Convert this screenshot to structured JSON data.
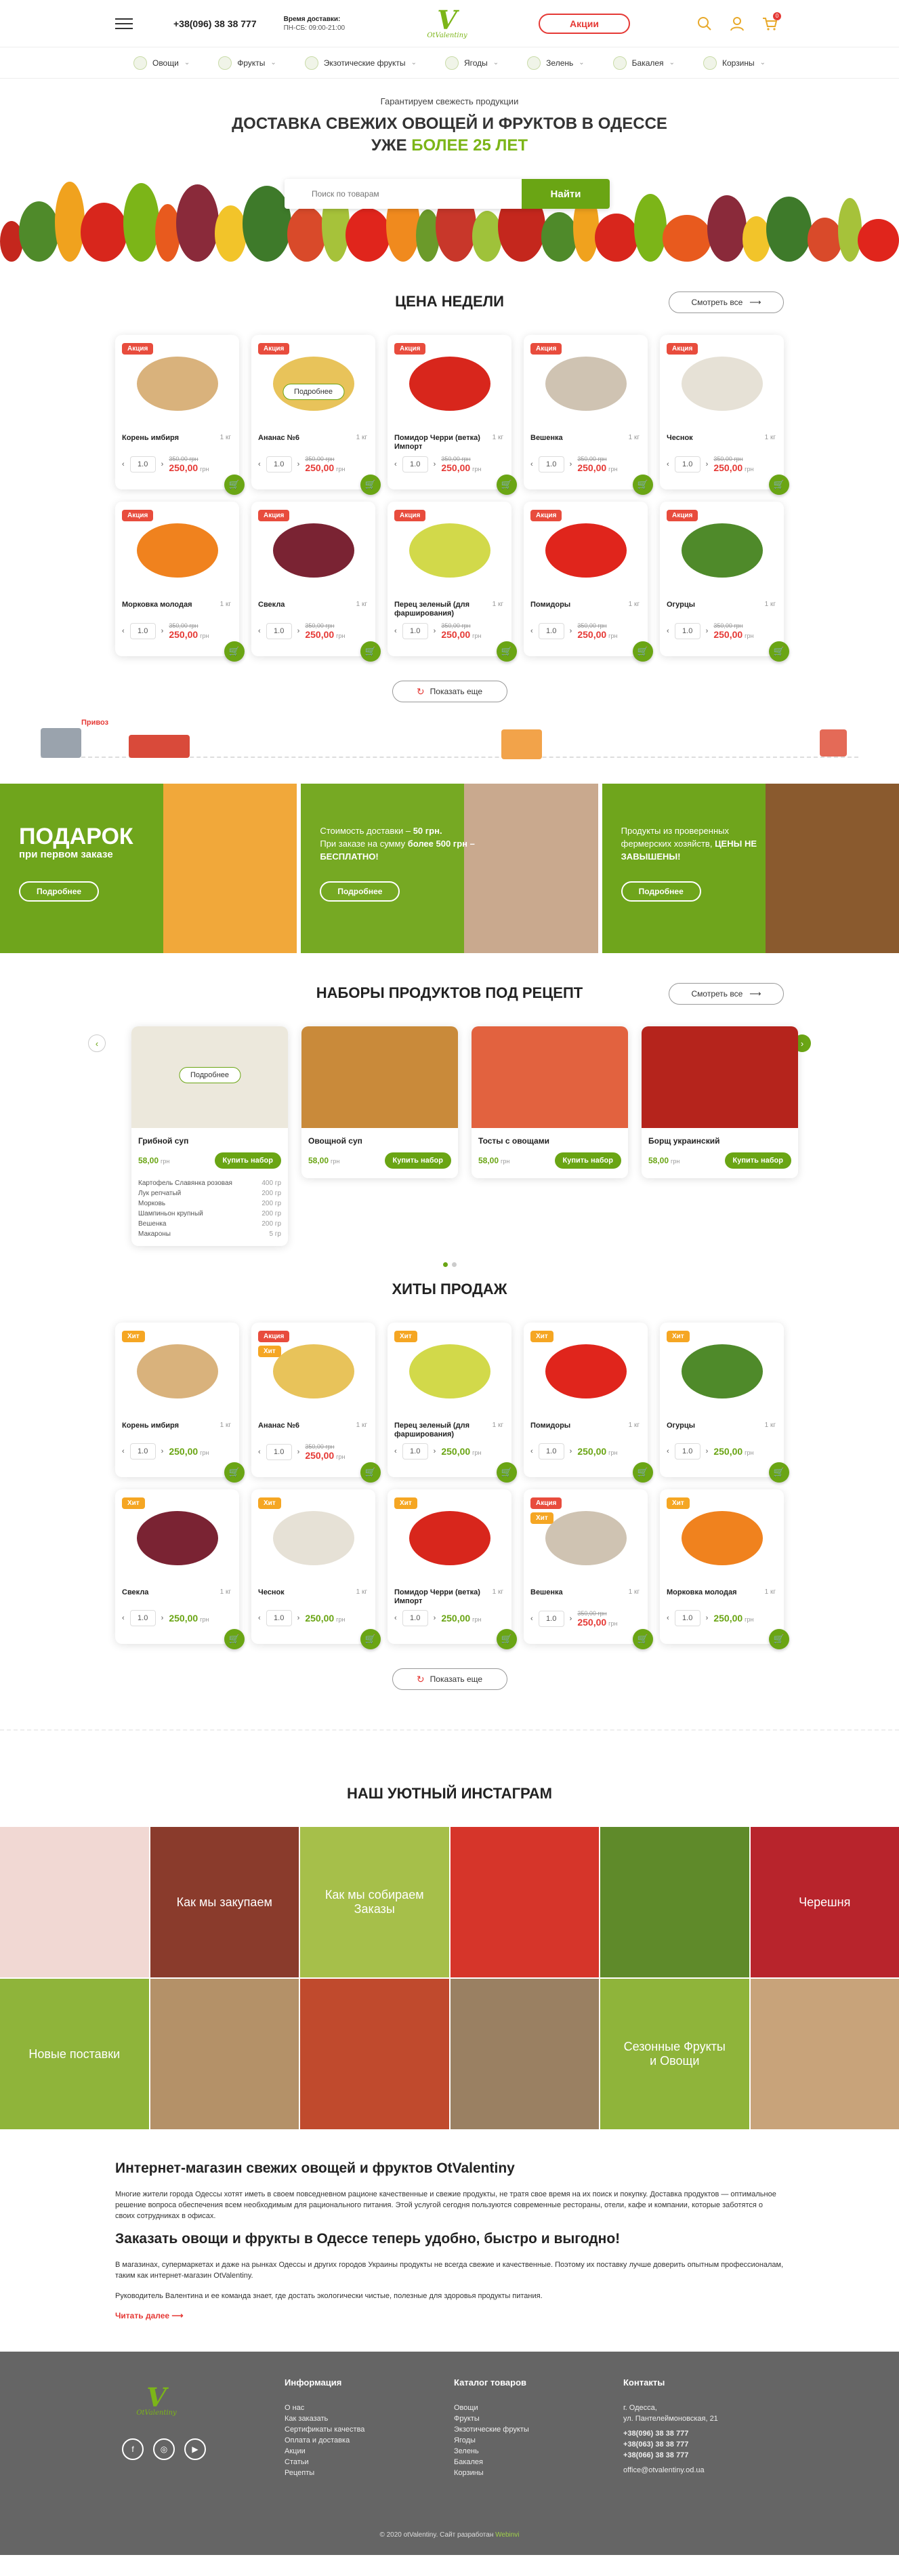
{
  "header": {
    "phone": "+38(096) 38 38 777",
    "hours_title": "Время доставки:",
    "hours": "ПН-СБ: 09:00-21:00",
    "logo": "OtValentiny",
    "promo": "Акции",
    "cart_count": "0"
  },
  "nav": [
    "Овощи",
    "Фрукты",
    "Экзотические фрукты",
    "Ягоды",
    "Зелень",
    "Бакалея",
    "Корзины"
  ],
  "hero": {
    "sub": "Гарантируем свежесть продукции",
    "title1": "ДОСТАВКА СВЕЖИХ ОВОЩЕЙ И ФРУКТОВ В ОДЕССЕ",
    "title2a": "УЖЕ ",
    "title2b": "БОЛЕЕ 25 ЛЕТ",
    "search_placeholder": "Поиск по товарам",
    "search_btn": "Найти"
  },
  "week": {
    "title": "ЦЕНА НЕДЕЛИ",
    "see_all": "Смотреть все",
    "more": "Показать еще",
    "products": [
      {
        "name": "Корень имбиря",
        "badge": "Акция",
        "unit": "1 кг",
        "old": "350,00 грн",
        "price": "250,00",
        "cur": "грн",
        "qty": "1.0",
        "color": "#d9b27c"
      },
      {
        "name": "Ананас №6",
        "badge": "Акция",
        "unit": "1 кг",
        "old": "350,00 грн",
        "price": "250,00",
        "cur": "грн",
        "qty": "1.0",
        "color": "#e8c35a",
        "detail": "Подробнее"
      },
      {
        "name": "Помидор Черри (ветка) Импорт",
        "badge": "Акция",
        "unit": "1 кг",
        "old": "350,00 грн",
        "price": "250,00",
        "cur": "грн",
        "qty": "1.0",
        "color": "#d8261c"
      },
      {
        "name": "Вешенка",
        "badge": "Акция",
        "unit": "1 кг",
        "old": "350,00 грн",
        "price": "250,00",
        "cur": "грн",
        "qty": "1.0",
        "color": "#cfc3b2"
      },
      {
        "name": "Чеснок",
        "badge": "Акция",
        "unit": "1 кг",
        "old": "350,00 грн",
        "price": "250,00",
        "cur": "грн",
        "qty": "1.0",
        "color": "#e6e1d6"
      },
      {
        "name": "Морковка молодая",
        "badge": "Акция",
        "unit": "1 кг",
        "old": "350,00 грн",
        "price": "250,00",
        "cur": "грн",
        "qty": "1.0",
        "color": "#f0821e"
      },
      {
        "name": "Свекла",
        "badge": "Акция",
        "unit": "1 кг",
        "old": "350,00 грн",
        "price": "250,00",
        "cur": "грн",
        "qty": "1.0",
        "color": "#7a2333"
      },
      {
        "name": "Перец зеленый (для фарширования)",
        "badge": "Акция",
        "unit": "1 кг",
        "old": "350,00 грн",
        "price": "250,00",
        "cur": "грн",
        "qty": "1.0",
        "color": "#d2d94a"
      },
      {
        "name": "Помидоры",
        "badge": "Акция",
        "unit": "1 кг",
        "old": "350,00 грн",
        "price": "250,00",
        "cur": "грн",
        "qty": "1.0",
        "color": "#e0251c"
      },
      {
        "name": "Огурцы",
        "badge": "Акция",
        "unit": "1 кг",
        "old": "350,00 грн",
        "price": "250,00",
        "cur": "грн",
        "qty": "1.0",
        "color": "#4f8a2a"
      }
    ]
  },
  "deco_label": "Привоз",
  "banners": [
    {
      "big": "ПОДАРОК",
      "mid": "при первом заказе",
      "btn": "Подробнее",
      "bg": "#6fa51c",
      "pic": "#f1a83a"
    },
    {
      "text1": "Стоимость доставки – ",
      "text1b": "50 грн.",
      "text2": "При заказе на сумму ",
      "text2b": "более 500 грн – БЕСПЛАТНО!",
      "btn": "Подробнее",
      "bg": "#76a923",
      "pic": "#c9a98e"
    },
    {
      "text1": "Продукты из проверенных фермерских хозяйств, ",
      "text1b": "ЦЕНЫ НЕ ЗАВЫШЕНЫ!",
      "btn": "Подробнее",
      "bg": "#6fa51c",
      "pic": "#8a5a2e"
    }
  ],
  "recipes": {
    "title": "НАБОРЫ ПРОДУКТОВ ПОД РЕЦЕПТ",
    "see_all": "Смотреть все",
    "items": [
      {
        "name": "Грибной суп",
        "price": "58,00",
        "cur": "грн",
        "btn": "Купить набор",
        "color": "#ece8dc",
        "detail": "Подробнее",
        "ingredients": [
          [
            "Картофель Славянка розовая",
            "400 гр"
          ],
          [
            "Лук репчатый",
            "200 гр"
          ],
          [
            "Морковь",
            "200 гр"
          ],
          [
            "Шампиньон крупный",
            "200 гр"
          ],
          [
            "Вешенка",
            "200 гр"
          ],
          [
            "Макароны",
            "5 гр"
          ]
        ]
      },
      {
        "name": "Овощной суп",
        "price": "58,00",
        "cur": "грн",
        "btn": "Купить набор",
        "color": "#c98a3a"
      },
      {
        "name": "Тосты с овощами",
        "price": "58,00",
        "cur": "грн",
        "btn": "Купить набор",
        "color": "#e2623f"
      },
      {
        "name": "Борщ украинский",
        "price": "58,00",
        "cur": "грн",
        "btn": "Купить набор",
        "color": "#b5241c"
      }
    ]
  },
  "hits": {
    "title": "ХИТЫ ПРОДАЖ",
    "more": "Показать еще",
    "products": [
      {
        "name": "Корень имбиря",
        "badge": "Хит",
        "unit": "1 кг",
        "price": "250,00",
        "cur": "грн",
        "qty": "1.0",
        "color": "#d9b27c"
      },
      {
        "name": "Ананас №6",
        "badge": "Акция",
        "badge2": "Хит",
        "unit": "1 кг",
        "old": "350,00 грн",
        "price": "250,00",
        "cur": "грн",
        "qty": "1.0",
        "color": "#e8c35a"
      },
      {
        "name": "Перец зеленый (для фарширования)",
        "badge": "Хит",
        "unit": "1 кг",
        "price": "250,00",
        "cur": "грн",
        "qty": "1.0",
        "color": "#d2d94a"
      },
      {
        "name": "Помидоры",
        "badge": "Хит",
        "unit": "1 кг",
        "price": "250,00",
        "cur": "грн",
        "qty": "1.0",
        "color": "#e0251c"
      },
      {
        "name": "Огурцы",
        "badge": "Хит",
        "unit": "1 кг",
        "price": "250,00",
        "cur": "грн",
        "qty": "1.0",
        "color": "#4f8a2a"
      },
      {
        "name": "Свекла",
        "badge": "Хит",
        "unit": "1 кг",
        "price": "250,00",
        "cur": "грн",
        "qty": "1.0",
        "color": "#7a2333"
      },
      {
        "name": "Чеснок",
        "badge": "Хит",
        "unit": "1 кг",
        "price": "250,00",
        "cur": "грн",
        "qty": "1.0",
        "color": "#e6e1d6"
      },
      {
        "name": "Помидор Черри (ветка) Импорт",
        "badge": "Хит",
        "unit": "1 кг",
        "price": "250,00",
        "cur": "грн",
        "qty": "1.0",
        "color": "#d8261c"
      },
      {
        "name": "Вешенка",
        "badge": "Акция",
        "badge2": "Хит",
        "unit": "1 кг",
        "old": "350,00 грн",
        "price": "250,00",
        "cur": "грн",
        "qty": "1.0",
        "color": "#cfc3b2"
      },
      {
        "name": "Морковка молодая",
        "badge": "Хит",
        "unit": "1 кг",
        "price": "250,00",
        "cur": "грн",
        "qty": "1.0",
        "color": "#f0821e"
      }
    ]
  },
  "instagram": {
    "title": "НАШ УЮТНЫЙ ИНСТАГРАМ",
    "tiles": [
      {
        "bg": "#f1d8d3",
        "text": ""
      },
      {
        "bg": "#8a3b2c",
        "text": "Как мы закупаем"
      },
      {
        "bg": "#a6bf4a",
        "text": "Как мы собираем Заказы"
      },
      {
        "bg": "#d6352a",
        "text": ""
      },
      {
        "bg": "#5f8a2a",
        "text": ""
      },
      {
        "bg": "#b8242c",
        "text": "Черешня"
      },
      {
        "bg": "#8fb43a",
        "text": "Новые поставки"
      },
      {
        "bg": "#b49168",
        "text": ""
      },
      {
        "bg": "#c04a2d",
        "text": ""
      },
      {
        "bg": "#9a8062",
        "text": ""
      },
      {
        "bg": "#8fb43a",
        "text": "Сезонные Фрукты и Овощи"
      },
      {
        "bg": "#c8a37a",
        "text": ""
      }
    ]
  },
  "seo": {
    "h1": "Интернет-магазин свежих овощей и фруктов OtValentiny",
    "p1": "Многие жители города Одессы хотят иметь в своем повседневном рационе качественные и свежие продукты, не тратя свое время на их поиск и покупку. Доставка продуктов — оптимальное решение вопроса обеспечения всем необходимым для рационального питания. Этой услугой сегодня пользуются современные рестораны, отели, кафе и компании, которые заботятся о своих сотрудниках в офисах.",
    "h2": "Заказать овощи и фрукты в Одессе теперь удобно, быстро и выгодно!",
    "p2": "В магазинах, супермаркетах и даже на рынках Одессы и других городов Украины продукты не всегда свежие и качественные. Поэтому их поставку лучше доверить опытным профессионалам, таким как интернет-магазин OtValentiny.",
    "p3": "Руководитель Валентина и ее команда знает, где достать экологически чистые, полезные для здоровья продукты питания.",
    "read_more": "Читать далее"
  },
  "footer": {
    "info_title": "Информация",
    "info": [
      "О нас",
      "Как заказать",
      "Сертификаты качества",
      "Оплата и доставка",
      "Акции",
      "Статьи",
      "Рецепты"
    ],
    "cat_title": "Каталог товаров",
    "cat": [
      "Овощи",
      "Фрукты",
      "Экзотические фрукты",
      "Ягоды",
      "Зелень",
      "Бакалея",
      "Корзины"
    ],
    "contacts_title": "Контакты",
    "addr1": "г. Одесса,",
    "addr2": "ул. Пантелеймоновская, 21",
    "phones": [
      "+38(096) 38 38 777",
      "+38(063) 38 38 777",
      "+38(066) 38 38 777"
    ],
    "email": "office@otvalentiny.od.ua",
    "copy": "© 2020 otValentiny. Сайт разработан ",
    "dev": "Webinvi"
  },
  "colors": {
    "green": "#6aa514",
    "red": "#e53935",
    "footer": "#656565"
  }
}
